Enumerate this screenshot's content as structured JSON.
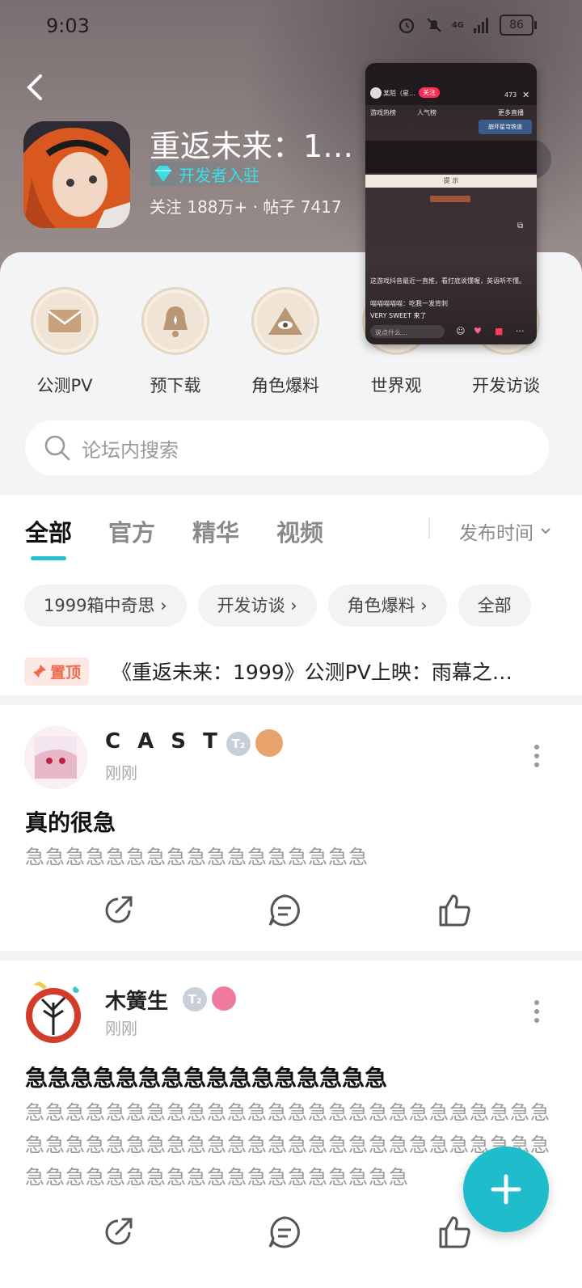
{
  "status": {
    "time": "9:03",
    "battery": "86",
    "network": "4G"
  },
  "game": {
    "title": "重返未来：1…",
    "dev_tag": "开发者入驻",
    "stats": "关注 188万+ · 帖子 7417"
  },
  "shortcuts": [
    {
      "label": "公测PV",
      "icon": "envelope-icon"
    },
    {
      "label": "预下载",
      "icon": "bell-icon"
    },
    {
      "label": "角色爆料",
      "icon": "eye-pyramid-icon"
    },
    {
      "label": "世界观",
      "icon": "globe-icon"
    },
    {
      "label": "开发访谈",
      "icon": "scroll-icon"
    }
  ],
  "search": {
    "placeholder": "论坛内搜索"
  },
  "tabs": [
    {
      "label": "全部",
      "active": true
    },
    {
      "label": "官方",
      "active": false
    },
    {
      "label": "精华",
      "active": false
    },
    {
      "label": "视频",
      "active": false
    }
  ],
  "sort": {
    "label": "发布时间"
  },
  "chips": [
    "1999箱中奇思 ›",
    "开发访谈 ›",
    "角色爆料 ›",
    "全部"
  ],
  "pinned": {
    "badge": "置顶",
    "text": "《重返未来：1999》公测PV上映：雨幕之…"
  },
  "posts": [
    {
      "user": "C A S T L E",
      "level": "T₂",
      "time": "刚刚",
      "title": "真的很急",
      "body": "急急急急急急急急急急急急急急急急急"
    },
    {
      "user": "木簧生",
      "level": "T₂",
      "time": "刚刚",
      "title": "急急急急急急急急急急急急急急急急",
      "body": "急急急急急急急急急急急急急急急急急急急急急急急急急急急急急急急急急急急急急急急急急急急急急急急急急急急急急急急急急急急急急急急急急急急急急急急"
    }
  ],
  "pip": {
    "streamer": "某陌（星…",
    "follow": "关注",
    "viewers": "473",
    "tag1": "游戏热榜",
    "tag2": "人气榜",
    "more_live": "更多直播",
    "game_banner": "崩坏星穹铁道",
    "hint": "提 示",
    "chat1": "这游戏抖音最近一直推，看打底说懂喔，英语听不懂。",
    "chat2": "喵喵喵喵喵：吃我一发背刺",
    "chat3": "VERY SWEET 来了",
    "input": "说点什么..."
  },
  "colors": {
    "accent": "#1fbccc",
    "pin": "#f06a4d",
    "dev": "#35e1e7"
  }
}
